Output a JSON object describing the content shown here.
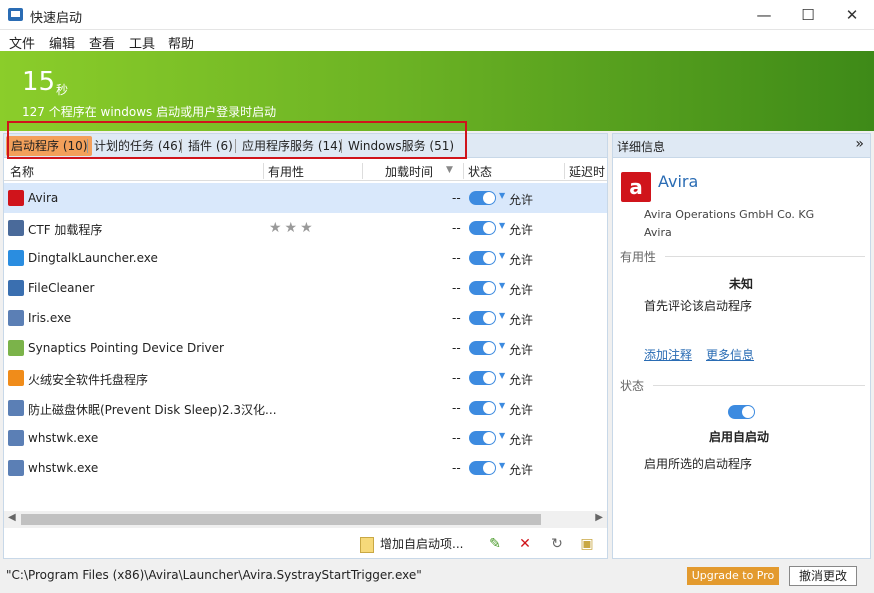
{
  "window": {
    "title": "快速启动",
    "min": "—",
    "max": "☐",
    "close": "✕"
  },
  "menu": [
    "文件",
    "编辑",
    "查看",
    "工具",
    "帮助"
  ],
  "banner": {
    "seconds": "15",
    "unit": "秒",
    "desc": "127 个程序在 windows 启动或用户登录时启动"
  },
  "tabs": [
    "启动程序 (10)",
    "计划的任务 (46)",
    "插件 (6)",
    "应用程序服务 (14)",
    "Windows服务 (51)"
  ],
  "columns": {
    "name": "名称",
    "usefulness": "有用性",
    "load_time": "加载时间",
    "status": "状态",
    "delay": "延迟时"
  },
  "rows": [
    {
      "name": "Avira",
      "icon": "avira-icon",
      "color": "#d0141b",
      "load": "--",
      "status": "允许"
    },
    {
      "name": "CTF 加载程序",
      "icon": "ctf-icon",
      "color": "#4a6a9a",
      "load": "--",
      "status": "允许",
      "stars": "★★★"
    },
    {
      "name": "DingtalkLauncher.exe",
      "icon": "dingtalk-icon",
      "color": "#2a8de0",
      "load": "--",
      "status": "允许"
    },
    {
      "name": "FileCleaner",
      "icon": "filecleaner-icon",
      "color": "#3a6fb0",
      "load": "--",
      "status": "允许"
    },
    {
      "name": "Iris.exe",
      "icon": "window-icon",
      "color": "#5b7fb5",
      "load": "--",
      "status": "允许"
    },
    {
      "name": "Synaptics Pointing Device Driver",
      "icon": "synaptics-icon",
      "color": "#7bb34a",
      "load": "--",
      "status": "允许"
    },
    {
      "name": "火绒安全软件托盘程序",
      "icon": "huorong-icon",
      "color": "#f08c1a",
      "load": "--",
      "status": "允许"
    },
    {
      "name": "防止磁盘休眠(Prevent Disk Sleep)2.3汉化...",
      "icon": "window-icon",
      "color": "#5b7fb5",
      "load": "--",
      "status": "允许"
    },
    {
      "name": "whstwk.exe",
      "icon": "window-icon",
      "color": "#5b7fb5",
      "load": "--",
      "status": "允许"
    },
    {
      "name": "whstwk.exe",
      "icon": "window-icon",
      "color": "#5b7fb5",
      "load": "--",
      "status": "允许"
    }
  ],
  "bottombar": {
    "add": "增加自启动项..."
  },
  "details": {
    "header": "详细信息",
    "app_name": "Avira",
    "company": "Avira Operations GmbH  Co. KG",
    "product": "Avira",
    "usefulness_label": "有用性",
    "usefulness_value": "未知",
    "usefulness_hint": "首先评论该启动程序",
    "add_note": "添加注释",
    "more_info": "更多信息",
    "status_label": "状态",
    "status_value": "启用自启动",
    "status_hint": "启用所选的启动程序"
  },
  "statusbar": {
    "path": "\"C:\\Program Files (x86)\\Avira\\Launcher\\Avira.SystrayStartTrigger.exe\"",
    "upgrade": "Upgrade to Pro",
    "undo": "撤消更改"
  }
}
